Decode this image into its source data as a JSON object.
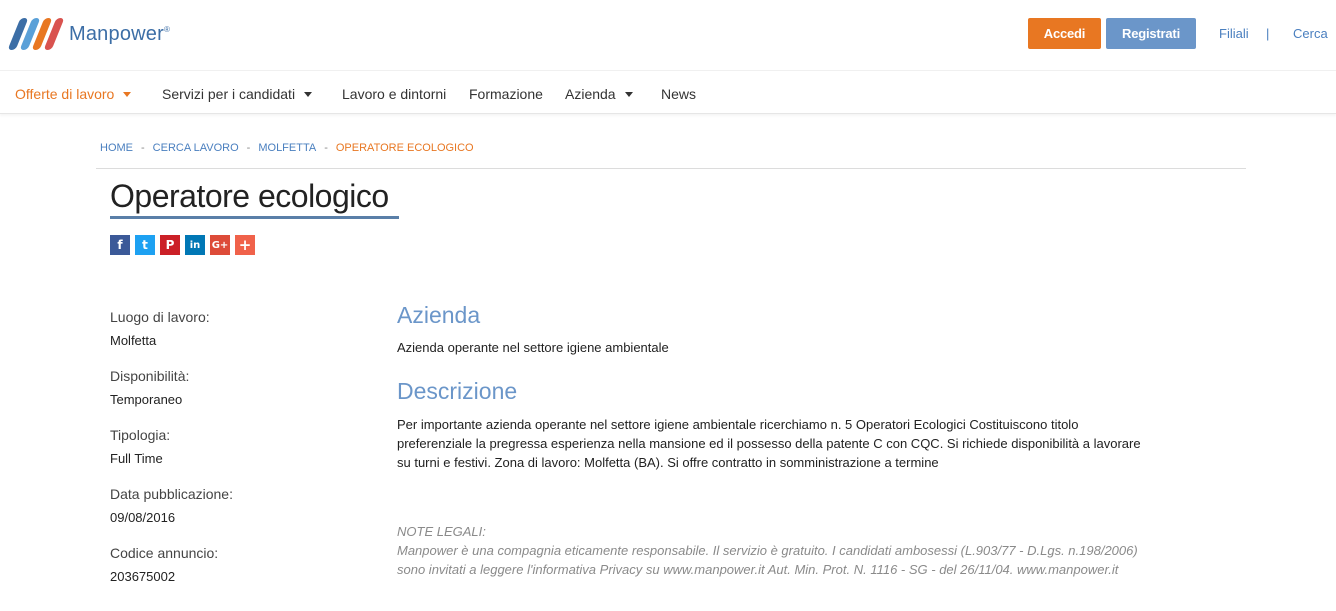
{
  "header": {
    "logo_text": "Manpower",
    "logo_mark": "®",
    "login_label": "Accedi",
    "register_label": "Registrati",
    "branches_label": "Filiali",
    "separator": "|",
    "search_label": "Cerca"
  },
  "nav": {
    "items": [
      {
        "label": "Offerte di lavoro",
        "dropdown": true,
        "active": true
      },
      {
        "label": "Servizi per i candidati",
        "dropdown": true
      },
      {
        "label": "Lavoro e dintorni"
      },
      {
        "label": "Formazione"
      },
      {
        "label": "Azienda",
        "dropdown": true
      },
      {
        "label": "News"
      }
    ]
  },
  "breadcrumb": {
    "items": [
      "HOME",
      "CERCA LAVORO",
      "MOLFETTA",
      "OPERATORE ECOLOGICO"
    ],
    "separator": "-"
  },
  "job": {
    "title": "Operatore ecologico",
    "details": [
      {
        "label": "Luogo di lavoro:",
        "value": "Molfetta"
      },
      {
        "label": "Disponibilità:",
        "value": "Temporaneo"
      },
      {
        "label": "Tipologia:",
        "value": "Full Time"
      },
      {
        "label": "Data pubblicazione:",
        "value": "09/08/2016"
      },
      {
        "label": "Codice annuncio:",
        "value": "203675002"
      }
    ],
    "company_heading": "Azienda",
    "company_text": "Azienda operante nel settore igiene ambientale",
    "description_heading": "Descrizione",
    "description_lines": [
      "Per importante azienda operante nel settore igiene ambientale ricerchiamo n. 5 Operatori Ecologici Costituiscono titolo",
      "preferenziale la pregressa esperienza nella mansione ed il possesso della patente C con CQC. Si richiede disponibilità a lavorare",
      "su turni e festivi. Zona di lavoro: Molfetta (BA). Si offre contratto in somministrazione a termine"
    ],
    "legal_lines": [
      "NOTE LEGALI:",
      "Manpower è una compagnia eticamente responsabile. Il servizio è gratuito. I candidati ambosessi (L.903/77 - D.Lgs. n.198/2006)",
      "sono invitati a leggere l'informativa Privacy su www.manpower.it Aut. Min. Prot. N. 1116 - SG - del 26/11/04. www.manpower.it"
    ]
  },
  "social": {
    "buttons": [
      {
        "icon": "facebook-icon",
        "glyph": "f",
        "color": "#3b5998"
      },
      {
        "icon": "twitter-icon",
        "glyph": "t",
        "color": "#1da1f2"
      },
      {
        "icon": "pinterest-icon",
        "glyph": "P",
        "color": "#cb2027"
      },
      {
        "icon": "linkedin-icon",
        "glyph": "in",
        "color": "#0077b5"
      },
      {
        "icon": "google-plus-icon",
        "glyph": "G+",
        "color": "#dd4b39"
      },
      {
        "icon": "share-more-icon",
        "glyph": "+",
        "color": "#f0624a"
      }
    ]
  },
  "colors": {
    "accent_orange": "#e87722",
    "brand_blue": "#6b96c9"
  }
}
